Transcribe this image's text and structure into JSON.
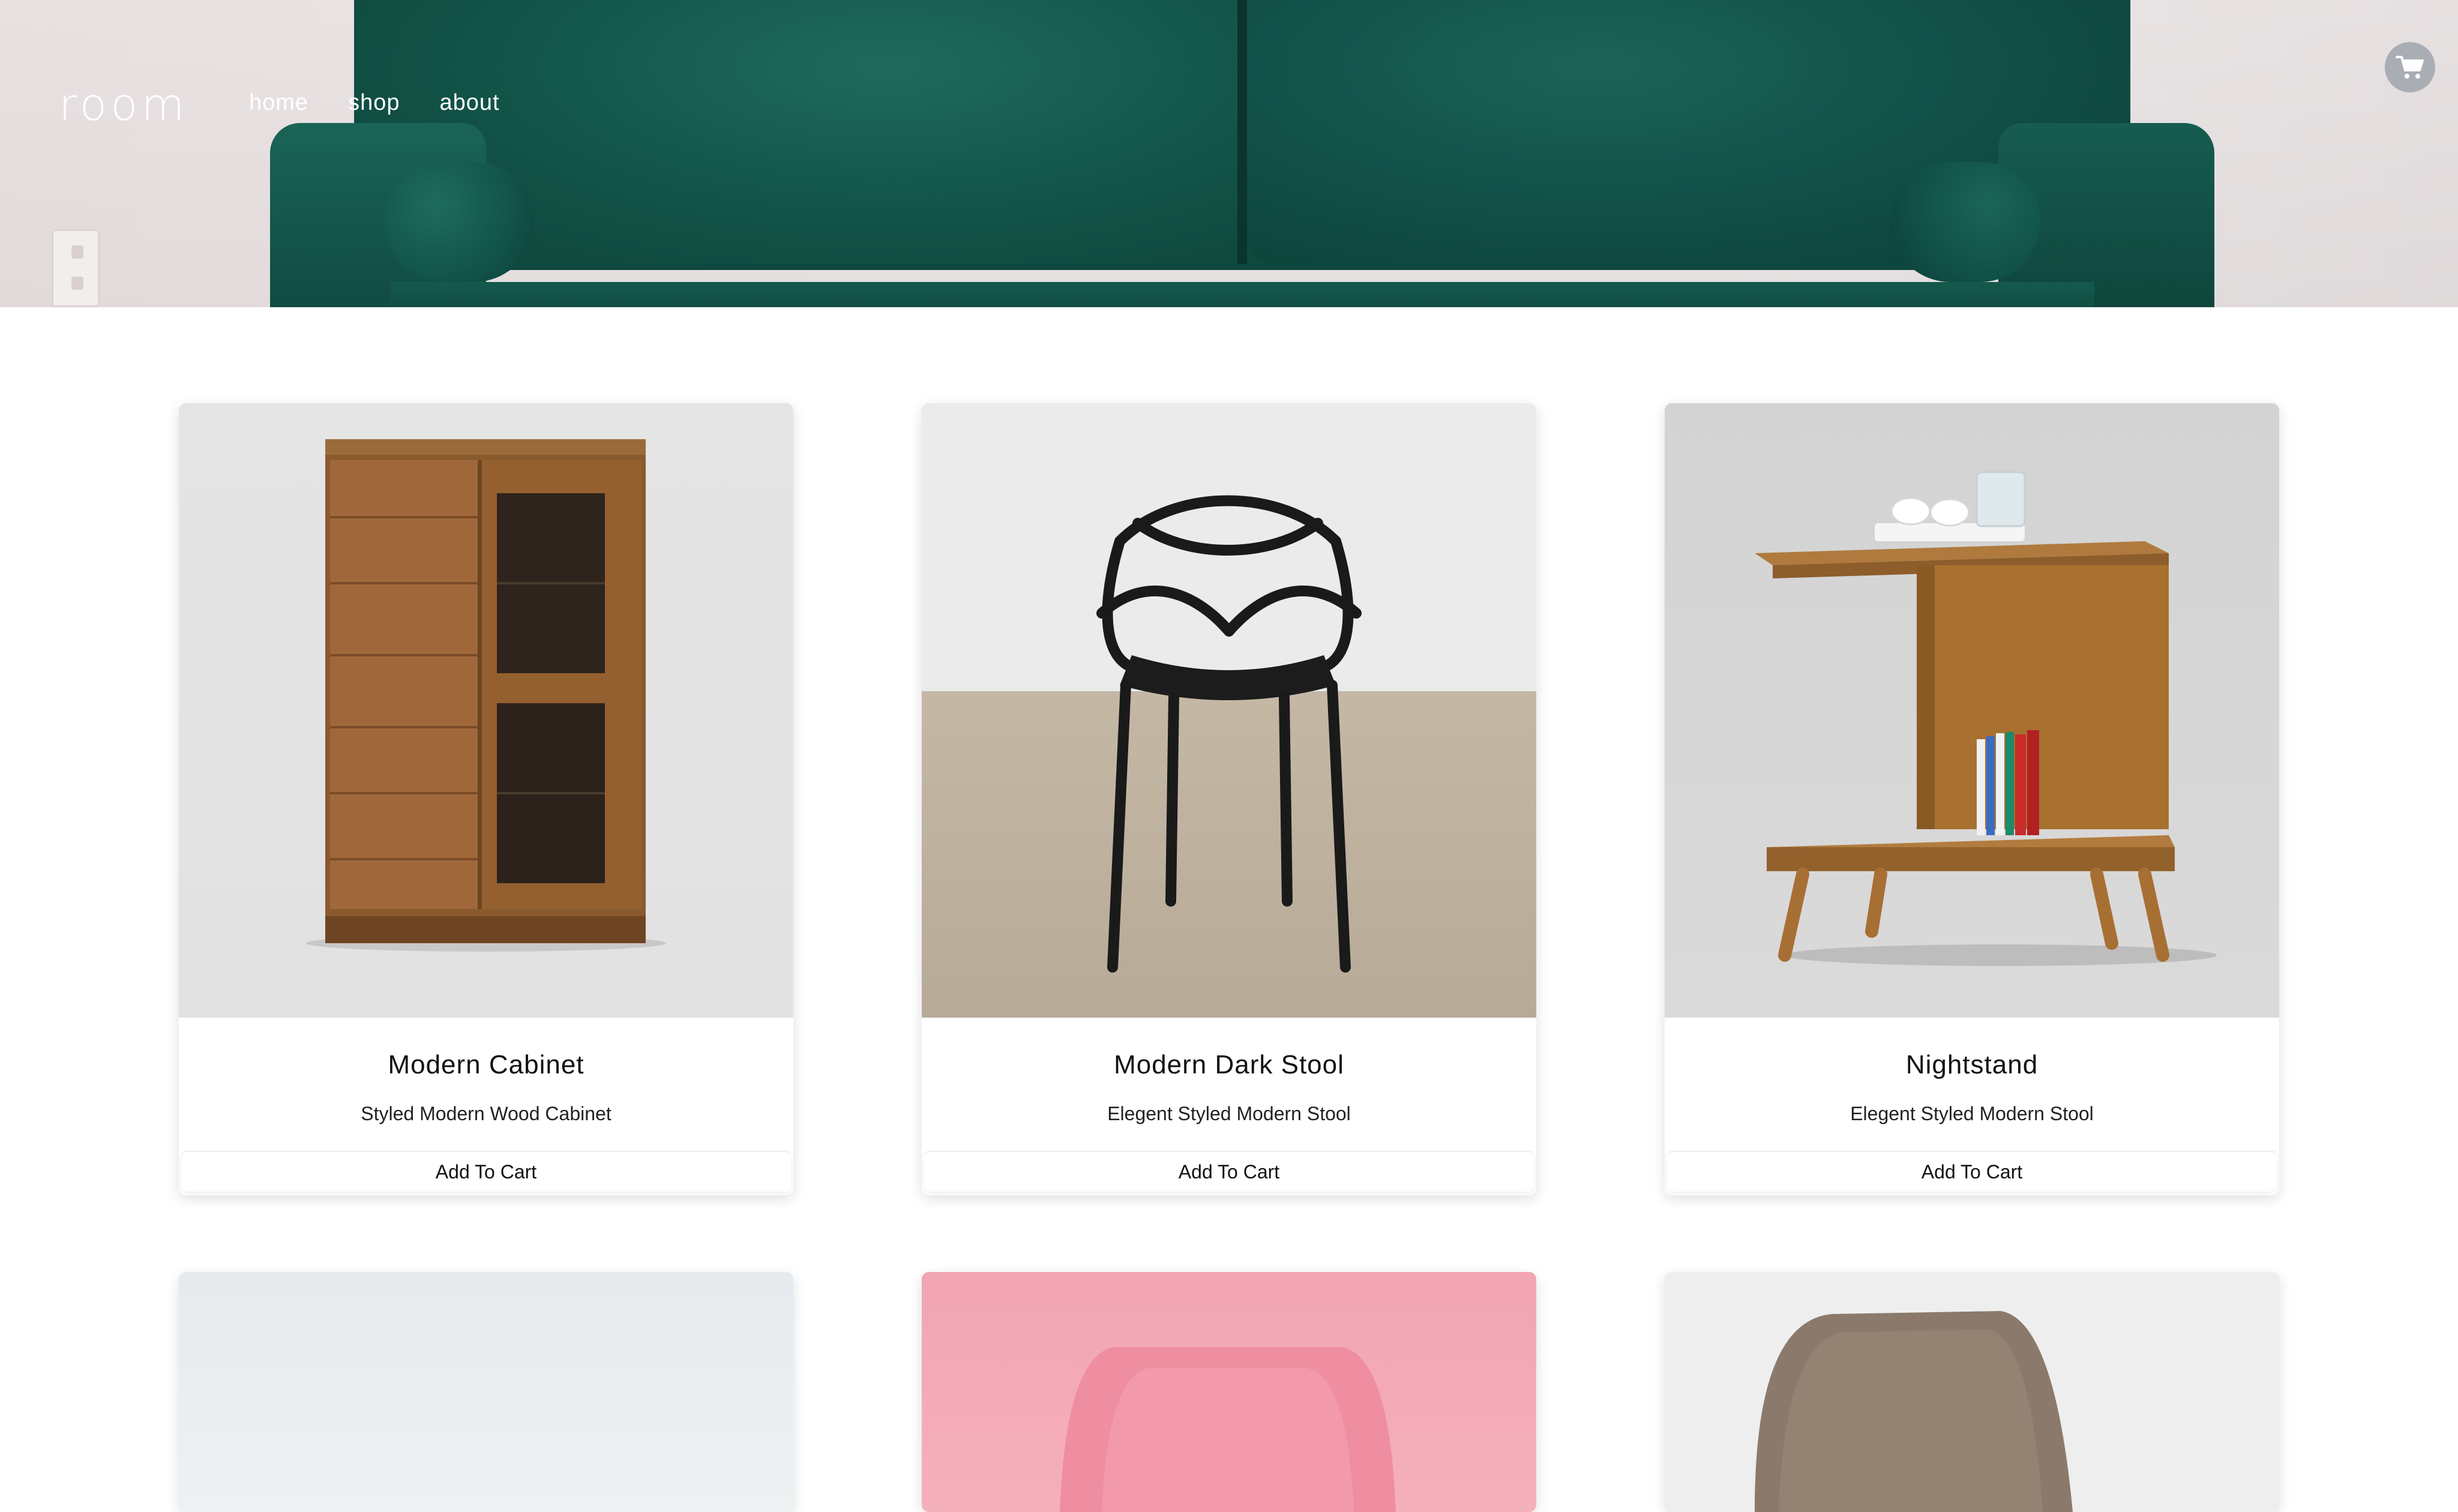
{
  "brand": {
    "logo": "room"
  },
  "nav": {
    "items": [
      "home",
      "shop",
      "about"
    ]
  },
  "cart": {
    "icon": "cart-icon"
  },
  "products": [
    {
      "title": "Modern Cabinet",
      "subtitle": "Styled Modern Wood Cabinet",
      "button": "Add To Cart"
    },
    {
      "title": "Modern Dark Stool",
      "subtitle": "Elegent Styled Modern Stool",
      "button": "Add To Cart"
    },
    {
      "title": "Nightstand",
      "subtitle": "Elegent Styled Modern Stool",
      "button": "Add To Cart"
    }
  ],
  "colors": {
    "accent_sofa": "#14584c",
    "cart_button": "#a9aeb4"
  }
}
